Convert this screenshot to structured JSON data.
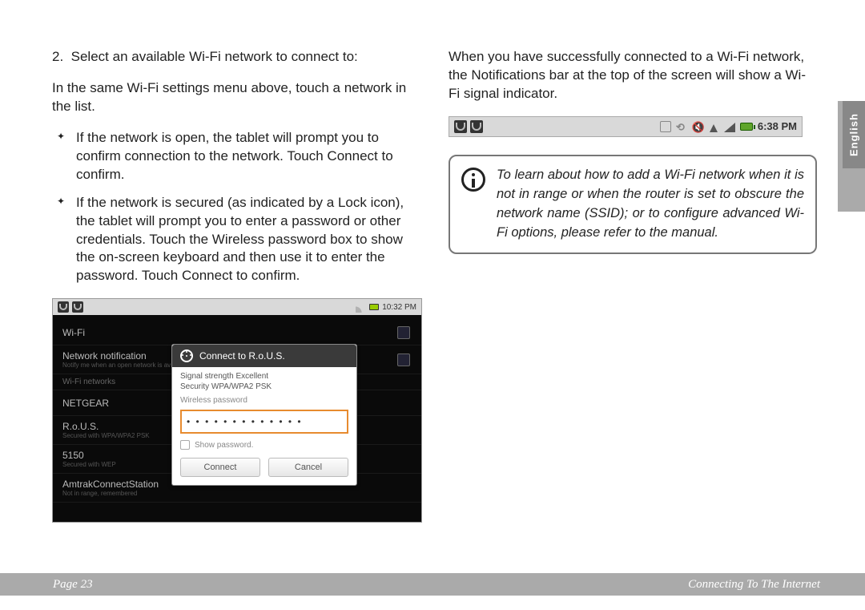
{
  "left": {
    "step_number": "2.",
    "step_title": "Select an available Wi-Fi network to connect to:",
    "intro": "In the same Wi-Fi settings menu above, touch a network in the list.",
    "bullet1_a": "If the network is open, the tablet will prompt you to confirm connection to the network. Touch ",
    "bullet1_b": " to confirm.",
    "bullet2_a": "If the network is secured (as indicated by a Lock icon), the tablet will prompt you to enter a password or other credentials.  Touch the Wireless password box to show the on-screen keyboard and then use it to enter the password. Touch ",
    "bullet2_b": " to confirm.",
    "connect_word": "Connect"
  },
  "right": {
    "para": "When you have successfully connected to a Wi-Fi network, the Notifications bar at the top of the screen will show a Wi-Fi signal indicator.",
    "info": "To learn about how to add a Wi-Fi network when it is not in range or when the router is set to obscure the network name (SSID); or to configure advanced Wi-Fi options, please refer to the manual."
  },
  "screenshot1": {
    "time": "10:32 PM",
    "rows": {
      "wifi": "Wi-Fi",
      "notif": "Network notification",
      "notif_sub": "Notify me when an open network is av",
      "sectHead": "Wi-Fi networks",
      "n1": "NETGEAR",
      "n2": "R.o.U.S.",
      "n2_sub": "Secured with WPA/WPA2 PSK",
      "n3": "5150",
      "n3_sub": "Secured with WEP",
      "n4": "AmtrakConnectStation",
      "n4_sub": "Not in range, remembered"
    },
    "dialog": {
      "title": "Connect to R.o.U.S.",
      "sig": "Signal strength  Excellent",
      "sec": "Security  WPA/WPA2 PSK",
      "pwlabel": "Wireless password",
      "pwdots": "• • • • • • • • • • • • •",
      "show": "Show password.",
      "connect": "Connect",
      "cancel": "Cancel"
    }
  },
  "screenshot2": {
    "time": "6:38 PM"
  },
  "footer": {
    "page": "Page 23",
    "section": "Connecting To The Internet"
  },
  "langtab": "English"
}
